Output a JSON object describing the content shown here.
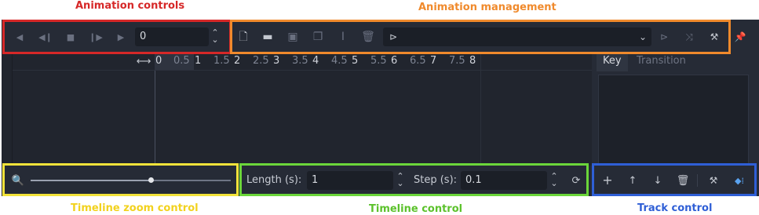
{
  "captions": {
    "animation_controls": "Animation controls",
    "animation_management": "Animation management",
    "timeline_zoom_control": "Timeline zoom control",
    "timeline_control": "Timeline control",
    "track_control": "Track control"
  },
  "playback": {
    "time_value": "0"
  },
  "timeline": {
    "ticks": [
      "0",
      "0.5",
      "1",
      "1.5",
      "2",
      "2.5",
      "3",
      "3.5",
      "4",
      "4.5",
      "5",
      "5.5",
      "6",
      "6.5",
      "7",
      "7.5",
      "8"
    ]
  },
  "inspector_tabs": {
    "key": "Key",
    "transition": "Transition"
  },
  "bottom": {
    "length_label": "Length (s):",
    "length_value": "1",
    "step_label": "Step (s):",
    "step_value": "0.1"
  },
  "zoom": {
    "level": 0.6
  },
  "colors": {
    "controls_box": "#d62828",
    "management_box": "#f08a2c",
    "zoom_box": "#f2e33a",
    "timeline_box": "#6bd63a",
    "track_box": "#2f5fd6"
  }
}
